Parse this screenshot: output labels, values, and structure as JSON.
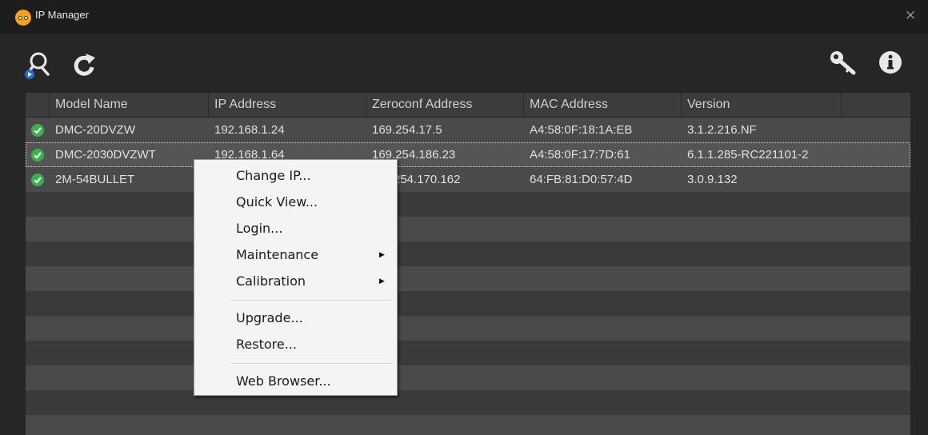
{
  "window": {
    "title": "IP Manager",
    "close_glyph": "×"
  },
  "toolbar": {
    "search_icon": "search-scan-icon",
    "refresh_icon": "refresh-icon",
    "key_icon": "key-icon",
    "info_icon": "info-icon"
  },
  "table": {
    "columns": [
      "Model Name",
      "IP Address",
      "Zeroconf Address",
      "MAC Address",
      "Version"
    ],
    "rows": [
      {
        "status": "ok",
        "model": "DMC-20DVZW",
        "ip": "192.168.1.24",
        "zeroconf": "169.254.17.5",
        "mac": "A4:58:0F:18:1A:EB",
        "version": "3.1.2.216.NF"
      },
      {
        "status": "ok",
        "model": "DMC-2030DVZWT",
        "ip": "192.168.1.64",
        "zeroconf": "169.254.186.23",
        "mac": "A4:58:0F:17:7D:61",
        "version": "6.1.1.285-RC221101-2"
      },
      {
        "status": "ok",
        "model": "2M-54BULLET",
        "ip": "",
        "zeroconf": "254.170.162",
        "mac": "64:FB:81:D0:57:4D",
        "version": "3.0.9.132"
      }
    ],
    "selected_row": 1
  },
  "context_menu": {
    "items": [
      {
        "label": "Change IP..."
      },
      {
        "label": "Quick View..."
      },
      {
        "label": "Login..."
      },
      {
        "label": "Maintenance",
        "submenu": true
      },
      {
        "label": "Calibration",
        "submenu": true
      },
      {
        "label": "Upgrade..."
      },
      {
        "label": "Restore..."
      },
      {
        "label": "Web Browser..."
      }
    ]
  },
  "colors": {
    "accent": "#1f6fd0",
    "status_ok": "#37b24d",
    "app_icon": "#f6a21a"
  }
}
